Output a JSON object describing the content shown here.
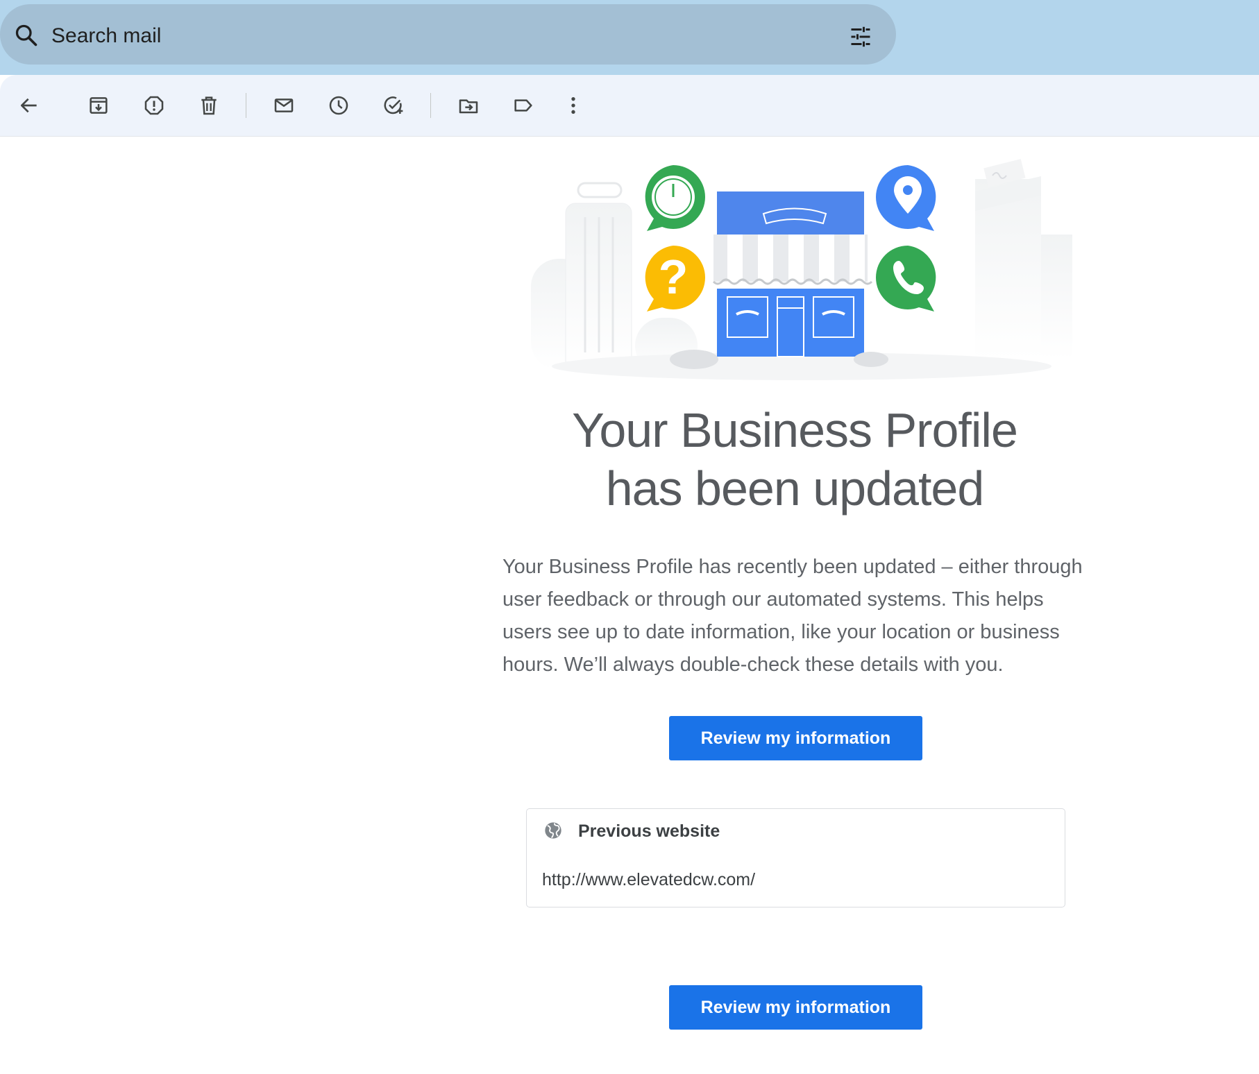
{
  "search": {
    "placeholder": "Search mail"
  },
  "toolbar": {
    "icons": [
      "back-arrow-icon",
      "archive-icon",
      "report-spam-icon",
      "delete-icon",
      "mark-unread-icon",
      "snooze-icon",
      "add-task-icon",
      "move-to-icon",
      "label-icon",
      "more-vert-icon"
    ],
    "icon_color": "#444746"
  },
  "email": {
    "headline_line1": "Your Business Profile",
    "headline_line2": "has been updated",
    "body": "Your Business Profile has recently been updated – either through user feedback or through our automated systems. This helps users see up to date information, like your location or business hours. We’ll always double-check these details with you.",
    "cta_label": "Review my information",
    "card": {
      "title": "Previous website",
      "value": "http://www.elevatedcw.com/"
    },
    "cta_bottom_label": "Review my information"
  },
  "colors": {
    "brand_blue": "#1a73e8",
    "search_band": "#b3d5ec",
    "search_bar": "#a3bfd4",
    "toolbar_bg": "#eef3fb",
    "green": "#34a853",
    "yellow": "#fbbc04",
    "blue_store": "#4285f4"
  }
}
